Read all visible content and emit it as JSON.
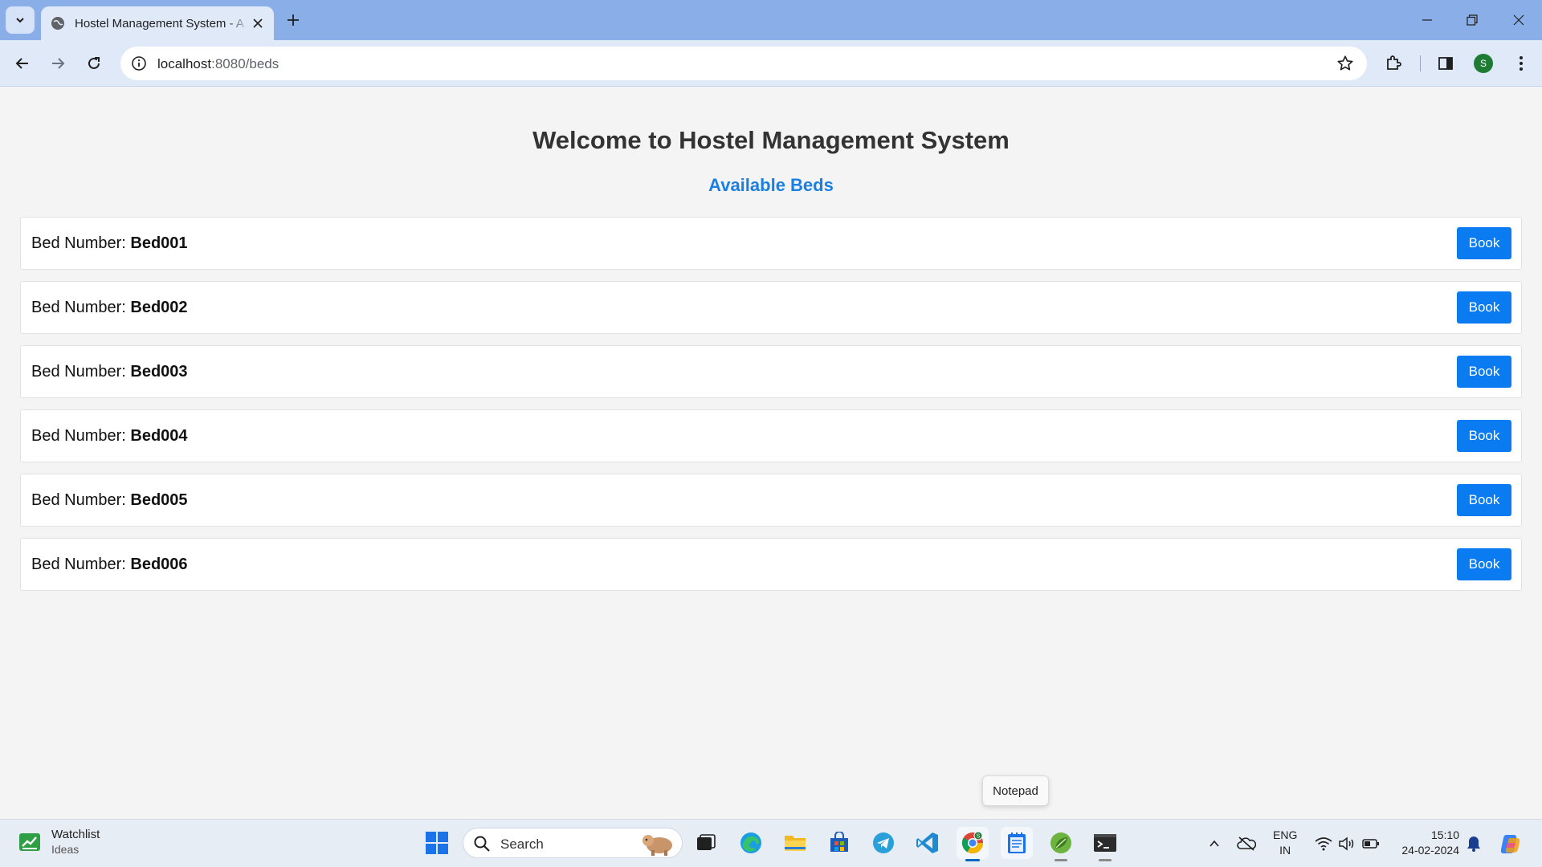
{
  "browser": {
    "tab_title": "Hostel Management System - A",
    "url_host": "localhost",
    "url_path": ":8080/beds",
    "profile_initial": "S"
  },
  "page": {
    "title": "Welcome to Hostel Management System",
    "subtitle": "Available Beds",
    "bed_label_prefix": "Bed Number: ",
    "book_label": "Book",
    "beds": [
      {
        "number": "Bed001"
      },
      {
        "number": "Bed002"
      },
      {
        "number": "Bed003"
      },
      {
        "number": "Bed004"
      },
      {
        "number": "Bed005"
      },
      {
        "number": "Bed006"
      }
    ]
  },
  "tooltip": {
    "text": "Notepad"
  },
  "taskbar": {
    "widget_title": "Watchlist",
    "widget_subtitle": "Ideas",
    "search_placeholder": "Search",
    "chrome_badge": "S",
    "lang_top": "ENG",
    "lang_bottom": "IN",
    "time": "15:10",
    "date": "24-02-2024"
  },
  "colors": {
    "accent": "#0a7bf0",
    "subtitle": "#1a7fe0",
    "tabbar": "#8aaee8",
    "toolbar": "#dfe9f8"
  },
  "icons": [
    "tab-search-icon",
    "globe-icon",
    "close-icon",
    "plus-icon",
    "minimize-icon",
    "restore-icon",
    "back-icon",
    "forward-icon",
    "reload-icon",
    "info-icon",
    "star-icon",
    "extensions-icon",
    "side-panel-icon",
    "menu-icon",
    "windows-start-icon",
    "search-icon",
    "task-view-icon",
    "edge-icon",
    "file-explorer-icon",
    "store-icon",
    "telegram-icon",
    "vscode-icon",
    "chrome-icon",
    "notepad-icon",
    "spring-icon",
    "terminal-icon",
    "chevron-up-icon",
    "onedrive-icon",
    "wifi-icon",
    "volume-icon",
    "battery-icon",
    "bell-icon",
    "copilot-icon"
  ]
}
